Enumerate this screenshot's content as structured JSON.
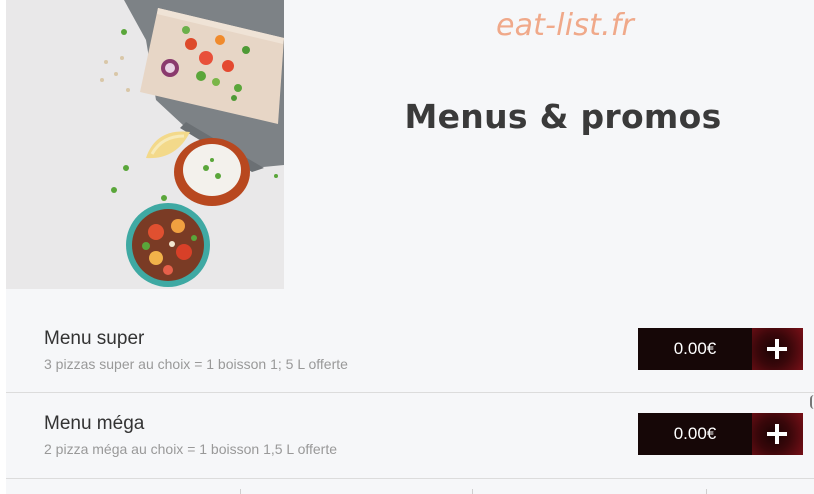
{
  "brand": {
    "name": "eat-list.fr"
  },
  "page": {
    "title": "Menus & promos"
  },
  "hero": {
    "image": "food-photo"
  },
  "menus": [
    {
      "name": "Menu super",
      "description": "3 pizzas super au choix = 1 boisson 1; 5 L offerte",
      "price": "0.00€",
      "add_icon": "plus-icon"
    },
    {
      "name": "Menu méga",
      "description": "2 pizza méga au choix = 1 boisson 1,5 L offerte",
      "price": "0.00€",
      "add_icon": "plus-icon"
    }
  ],
  "colors": {
    "brand": "#f0a98a",
    "price_bg": "#160707",
    "add_bg": "#7a1018",
    "background": "#f6f7f9"
  }
}
